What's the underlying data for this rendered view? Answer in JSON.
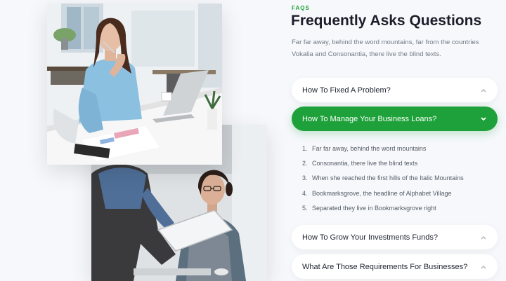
{
  "faq": {
    "eyebrow": "FAQS",
    "title": "Frequently Asks Questions",
    "intro": "Far far away, behind the word mountains, far from the countries Vokalia and Consonantia, there live the blind texts.",
    "accent_color": "#1ea13a",
    "items": [
      {
        "question": "How To Fixed A Problem?",
        "expanded": false,
        "icon": "chevron-up-icon"
      },
      {
        "question": "How To Manage Your Business Loans?",
        "expanded": true,
        "icon": "chevron-down-icon"
      },
      {
        "question": "How To Grow Your Investments Funds?",
        "expanded": false,
        "icon": "chevron-up-icon"
      },
      {
        "question": "What Are Those Requirements For Businesses?",
        "expanded": false,
        "icon": "chevron-up-icon"
      }
    ],
    "answer": [
      {
        "num": "1.",
        "text": "Far far away, behind the word mountains"
      },
      {
        "num": "2.",
        "text": "Consonantia, there live the blind texts"
      },
      {
        "num": "3.",
        "text": "When she reached the first hills of the Italic Mountains"
      },
      {
        "num": "4.",
        "text": "Bookmarksgrove, the headline of Alphabet Village"
      },
      {
        "num": "5.",
        "text": "Separated they live in Bookmarksgrove right"
      }
    ]
  },
  "images": [
    {
      "subject": "woman-at-desk-photo"
    },
    {
      "subject": "colleagues-with-tablet-photo"
    }
  ]
}
